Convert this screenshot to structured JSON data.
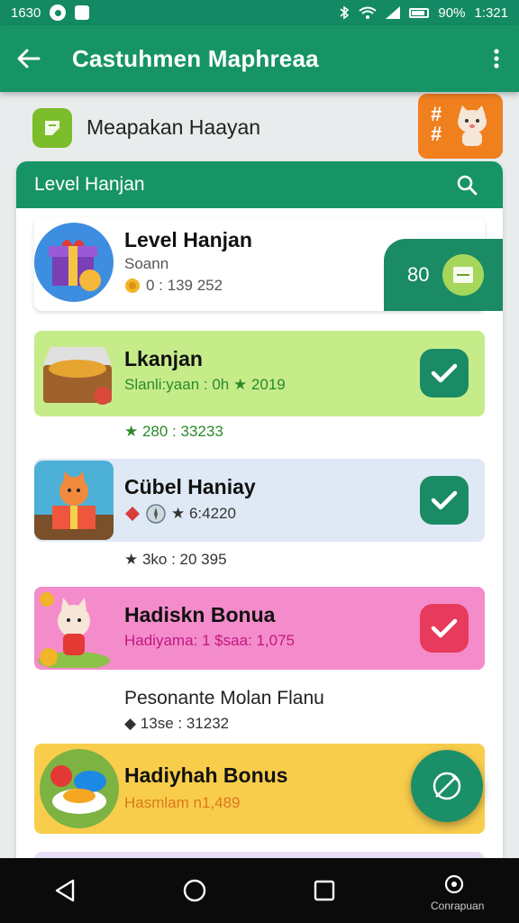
{
  "status_bar": {
    "time_left": "1630",
    "battery_text": "90%",
    "time_right": "1:321"
  },
  "app_bar": {
    "title": "Castuhmen Maphreaa"
  },
  "sub_header": {
    "title": "Meapakan Haayan"
  },
  "panel": {
    "title": "Level Hanjan"
  },
  "rows": [
    {
      "title": "Level Hanjan",
      "subtitle": "Soann",
      "detail": "0 : 139 252",
      "badge_value": "80",
      "color": "#ffffff"
    },
    {
      "title": "Lkanjan",
      "detail": "Slanli:yaan : 0h ★ 2019",
      "meta": "★ 280 : 33233",
      "color": "#c6ec8a",
      "status": "checked"
    },
    {
      "title": "Cübel Haniay",
      "detail": "★ 6:4220",
      "meta": "★ 3ko : 20 395",
      "color": "#dfe9f5",
      "status": "checked"
    },
    {
      "title": "Hadiskn Bonua",
      "detail": "Hadiyama: 1 $saa: 1,075",
      "color": "#f48ccb",
      "status": "checked"
    },
    {
      "title": "Pesonante Molan Flanu",
      "meta": "◆ 13se : 31232"
    },
    {
      "title": "Hadiyhah Bonus",
      "detail": "Hasmlam n1,489",
      "color": "#f9cd4c"
    }
  ],
  "nav": {
    "label": "Conrapuan"
  },
  "colors": {
    "primary": "#179466",
    "check_green": "#1a8b64",
    "check_red": "#e83a5c",
    "promo": "#f07f1e"
  }
}
